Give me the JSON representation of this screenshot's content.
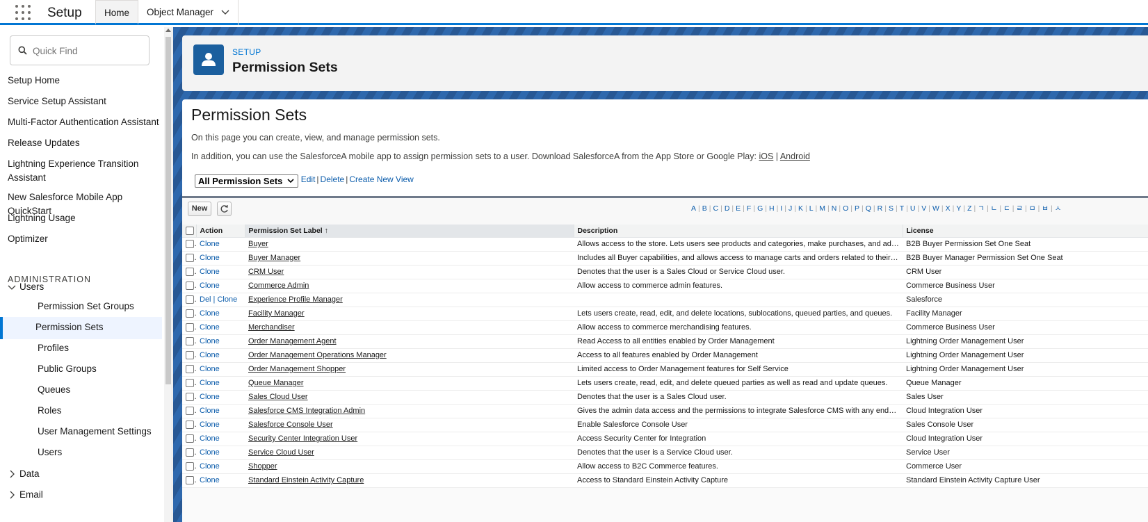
{
  "topbar": {
    "app_name": "Setup",
    "tabs": [
      {
        "label": "Home"
      },
      {
        "label": "Object Manager"
      }
    ]
  },
  "sidebar": {
    "search_placeholder": "Quick Find",
    "items": [
      {
        "label": "Setup Home"
      },
      {
        "label": "Service Setup Assistant"
      },
      {
        "label": "Multi-Factor Authentication Assistant"
      },
      {
        "label": "Release Updates"
      },
      {
        "label": "Lightning Experience Transition Assistant"
      },
      {
        "label": "New Salesforce Mobile App QuickStart"
      },
      {
        "label": "Lightning Usage"
      },
      {
        "label": "Optimizer"
      }
    ],
    "section_title": "ADMINISTRATION",
    "users_group": "Users",
    "users_children": [
      {
        "label": "Permission Set Groups"
      },
      {
        "label": "Permission Sets"
      },
      {
        "label": "Profiles"
      },
      {
        "label": "Public Groups"
      },
      {
        "label": "Queues"
      },
      {
        "label": "Roles"
      },
      {
        "label": "User Management Settings"
      },
      {
        "label": "Users"
      }
    ],
    "data_group": "Data",
    "email_group": "Email"
  },
  "header": {
    "breadcrumb": "SETUP",
    "title": "Permission Sets"
  },
  "main": {
    "page_title": "Permission Sets",
    "intro_line1": "On this page you can create, view, and manage permission sets.",
    "intro_line2": "In addition, you can use the SalesforceA mobile app to assign permission sets to a user. Download SalesforceA from the App Store or Google Play:",
    "ios_link": "iOS",
    "android_link": "Android",
    "link_separator": "|",
    "view_select": "All Permission Sets",
    "view_links": {
      "edit": "Edit",
      "delete": "Delete",
      "create": "Create New View"
    },
    "new_button": "New",
    "alphabet": [
      "A",
      "B",
      "C",
      "D",
      "E",
      "F",
      "G",
      "H",
      "I",
      "J",
      "K",
      "L",
      "M",
      "N",
      "O",
      "P",
      "Q",
      "R",
      "S",
      "T",
      "U",
      "V",
      "W",
      "X",
      "Y",
      "Z",
      "ㄱ",
      "ㄴ",
      "ㄷ",
      "ㄹ",
      "ㅁ",
      "ㅂ",
      "ㅅ"
    ],
    "columns": {
      "action": "Action",
      "label": "Permission Set Label",
      "sort_indicator": "↑",
      "description": "Description",
      "license": "License"
    },
    "rows": [
      {
        "action": "Clone",
        "label": "Buyer",
        "description": "Allows access to the store. Lets users see products and categories, make purchases, and add ...",
        "license": "B2B Buyer Permission Set One Seat"
      },
      {
        "action": "Clone",
        "label": "Buyer Manager",
        "description": "Includes all Buyer capabilities, and allows access to manage carts and orders related to their a...",
        "license": "B2B Buyer Manager Permission Set One Seat"
      },
      {
        "action": "Clone",
        "label": "CRM User",
        "description": "Denotes that the user is a Sales Cloud or Service Cloud user.",
        "license": "CRM User"
      },
      {
        "action": "Clone",
        "label": "Commerce Admin",
        "description": "Allow access to commerce admin features.",
        "license": "Commerce Business User"
      },
      {
        "action": "Del | Clone",
        "label": "Experience Profile Manager",
        "description": "",
        "license": "Salesforce"
      },
      {
        "action": "Clone",
        "label": "Facility Manager",
        "description": "Lets users create, read, edit, and delete locations, sublocations, queued parties, and queues.",
        "license": "Facility Manager"
      },
      {
        "action": "Clone",
        "label": "Merchandiser",
        "description": "Allow access to commerce merchandising features.",
        "license": "Commerce Business User"
      },
      {
        "action": "Clone",
        "label": "Order Management Agent",
        "description": "Read Access to all entities enabled by Order Management",
        "license": "Lightning Order Management User"
      },
      {
        "action": "Clone",
        "label": "Order Management Operations Manager",
        "description": "Access to all features enabled by Order Management",
        "license": "Lightning Order Management User"
      },
      {
        "action": "Clone",
        "label": "Order Management Shopper",
        "description": "Limited access to Order Management features for Self Service",
        "license": "Lightning Order Management User"
      },
      {
        "action": "Clone",
        "label": "Queue Manager",
        "description": "Lets users create, read, edit, and delete queued parties as well as read and update queues.",
        "license": "Queue Manager"
      },
      {
        "action": "Clone",
        "label": "Sales Cloud User",
        "description": "Denotes that the user is a Sales Cloud user.",
        "license": "Sales User"
      },
      {
        "action": "Clone",
        "label": "Salesforce CMS Integration Admin",
        "description": "Gives the admin data access and the permissions to integrate Salesforce CMS with any endpoint.",
        "license": "Cloud Integration User"
      },
      {
        "action": "Clone",
        "label": "Salesforce Console User",
        "description": "Enable Salesforce Console User",
        "license": "Sales Console User"
      },
      {
        "action": "Clone",
        "label": "Security Center Integration User",
        "description": "Access Security Center for Integration",
        "license": "Cloud Integration User"
      },
      {
        "action": "Clone",
        "label": "Service Cloud User",
        "description": "Denotes that the user is a Service Cloud user.",
        "license": "Service User"
      },
      {
        "action": "Clone",
        "label": "Shopper",
        "description": "Allow access to B2C Commerce features.",
        "license": "Commerce User"
      },
      {
        "action": "Clone",
        "label": "Standard Einstein Activity Capture",
        "description": "Access to Standard Einstein Activity Capture",
        "license": "Standard Einstein Activity Capture User"
      }
    ]
  },
  "colors": {
    "brand": "#0176d3",
    "link": "#0b5cab",
    "header_icon": "#1b5f9e"
  }
}
